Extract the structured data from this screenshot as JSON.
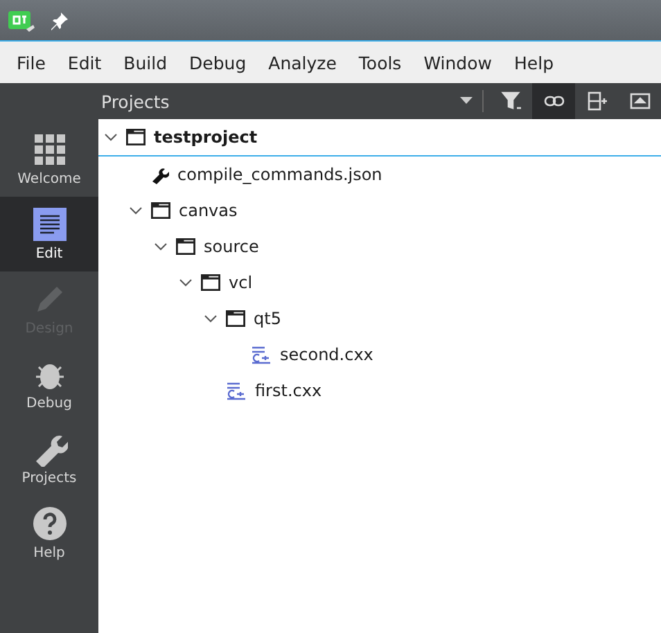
{
  "title_bar": {
    "pinned": true
  },
  "menu": [
    "File",
    "Edit",
    "Build",
    "Debug",
    "Analyze",
    "Tools",
    "Window",
    "Help"
  ],
  "modes": [
    {
      "label": "Welcome",
      "kind": "grid",
      "selected": false,
      "disabled": false
    },
    {
      "label": "Edit",
      "kind": "edit",
      "selected": true,
      "disabled": false
    },
    {
      "label": "Design",
      "kind": "pencil",
      "selected": false,
      "disabled": true
    },
    {
      "label": "Debug",
      "kind": "bug",
      "selected": false,
      "disabled": false
    },
    {
      "label": "Projects",
      "kind": "wrench",
      "selected": false,
      "disabled": false
    },
    {
      "label": "Help",
      "kind": "help",
      "selected": false,
      "disabled": false
    }
  ],
  "pane": {
    "title": "Projects",
    "tools": [
      {
        "kind": "filter",
        "on": false
      },
      {
        "kind": "link",
        "on": true
      },
      {
        "kind": "split",
        "on": false
      },
      {
        "kind": "hide",
        "on": false
      }
    ]
  },
  "tree": [
    {
      "name": "testproject",
      "kind": "project",
      "expanded": true,
      "selected": true,
      "children": [
        {
          "name": "compile_commands.json",
          "kind": "wrench",
          "selected": false
        },
        {
          "name": "canvas",
          "kind": "folder",
          "expanded": true,
          "selected": false,
          "children": [
            {
              "name": "source",
              "kind": "folder",
              "expanded": true,
              "selected": false,
              "children": [
                {
                  "name": "vcl",
                  "kind": "folder",
                  "expanded": true,
                  "selected": false,
                  "children": [
                    {
                      "name": "qt5",
                      "kind": "folder",
                      "expanded": true,
                      "selected": false,
                      "children": [
                        {
                          "name": "second.cxx",
                          "kind": "cpp",
                          "selected": false
                        }
                      ]
                    },
                    {
                      "name": "first.cxx",
                      "kind": "cpp",
                      "selected": false
                    }
                  ]
                }
              ]
            }
          ]
        }
      ]
    }
  ]
}
